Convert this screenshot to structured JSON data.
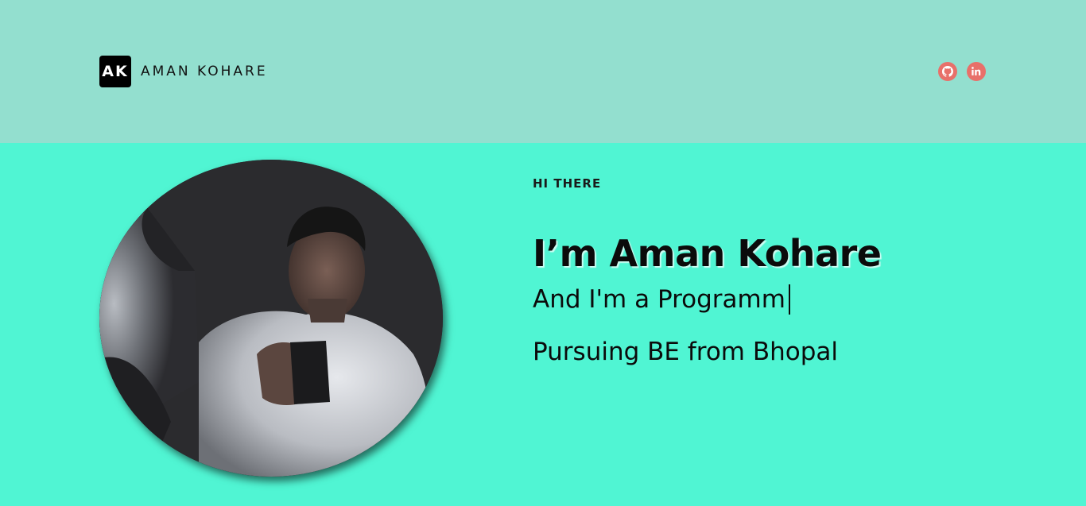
{
  "header": {
    "logo_mark": "AK",
    "logo_name": "AMAN KOHARE",
    "socials": [
      {
        "name": "github",
        "icon": "github-icon"
      },
      {
        "name": "linkedin",
        "icon": "linkedin-icon",
        "glyph": "in"
      }
    ]
  },
  "hero": {
    "greeting": "HI THERE",
    "name": "I’m Aman Kohare",
    "typed_text": "And I'm a Programm",
    "subtitle": "Pursuing BE from Bhopal",
    "photo_icon": "profile-photo"
  },
  "colors": {
    "header_bg": "#93dfcf",
    "hero_bg": "#50f5d3",
    "social_accent": "#e8706a",
    "logo_bg": "#000000"
  }
}
